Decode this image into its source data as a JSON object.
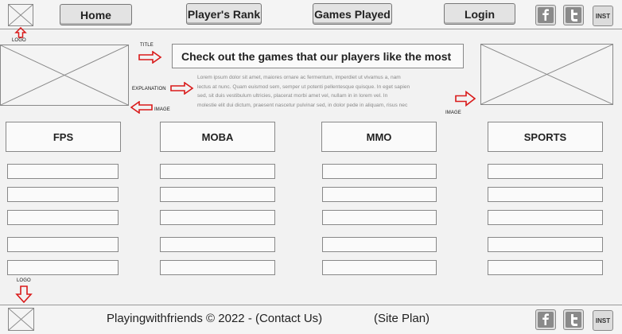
{
  "header": {
    "nav": {
      "home": "Home",
      "players_rank": "Player's Rank",
      "games_played": "Games Played",
      "login": "Login"
    },
    "social": {
      "inst": "INST"
    }
  },
  "annotations": {
    "logo_top": "LOGO",
    "title": "TITLE",
    "explanation": "EXPLANATION",
    "image_left": "IMAGE",
    "image_right": "IMAGE",
    "logo_bottom": "LOGO"
  },
  "main": {
    "title": "Check out the games that our players like the most",
    "explanation_lines": [
      "Lorem ipsum dolor sit amet, maiores ornare ac fermentum, imperdiet ut vivamus a, nam",
      "lectus at nunc. Quam euismod sem, semper ut potenti pellentesque quisque. In eget sapien",
      "sed, sit duis vestibulum ultricies, placerat morbi amet vel, nullam in in lorem vel. In",
      "molestie elit dui dictum, praesent nascetur pulvinar sed, in dolor pede in aliquam, risus nec"
    ],
    "categories": [
      "FPS",
      "MOBA",
      "MMO",
      "SPORTS"
    ]
  },
  "footer": {
    "copyright": "Playingwithfriends © 2022 - (Contact Us)",
    "site_plan": "(Site Plan)",
    "social": {
      "inst": "INST"
    }
  },
  "colors": {
    "arrow": "#d91a1a",
    "border": "#888888",
    "button": "#e3e3e3"
  },
  "icons": [
    "logo-placeholder-icon",
    "facebook-icon",
    "twitter-icon",
    "arrow-icon"
  ]
}
